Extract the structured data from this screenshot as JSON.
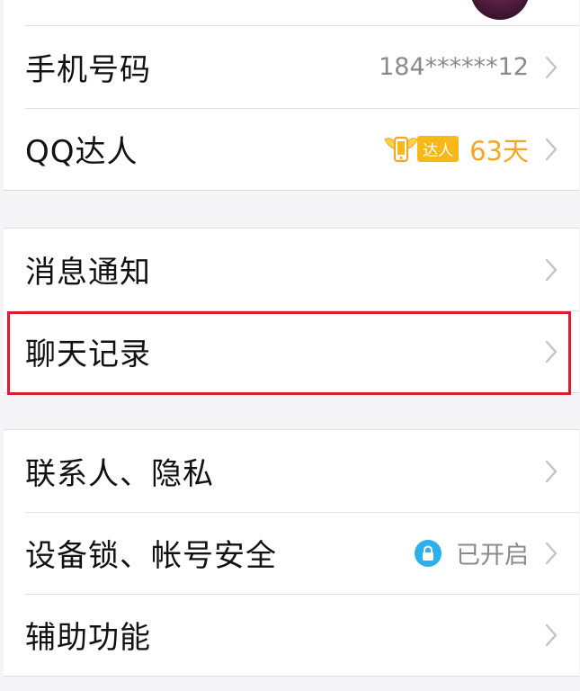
{
  "profile": {
    "phone": {
      "label": "手机号码",
      "value": "184******12"
    },
    "qq_daren": {
      "label": "QQ达人",
      "badge_text": "达人",
      "days": "63天"
    }
  },
  "settings_group_1": {
    "notifications": {
      "label": "消息通知"
    },
    "chat_history": {
      "label": "聊天记录"
    }
  },
  "settings_group_2": {
    "contacts_privacy": {
      "label": "联系人、隐私"
    },
    "device_lock": {
      "label": "设备锁、帐号安全",
      "status": "已开启"
    },
    "accessibility": {
      "label": "辅助功能"
    }
  },
  "colors": {
    "highlight_border": "#d81e2b",
    "daren_orange": "#f5a623",
    "lock_blue": "#2bb0ec"
  }
}
